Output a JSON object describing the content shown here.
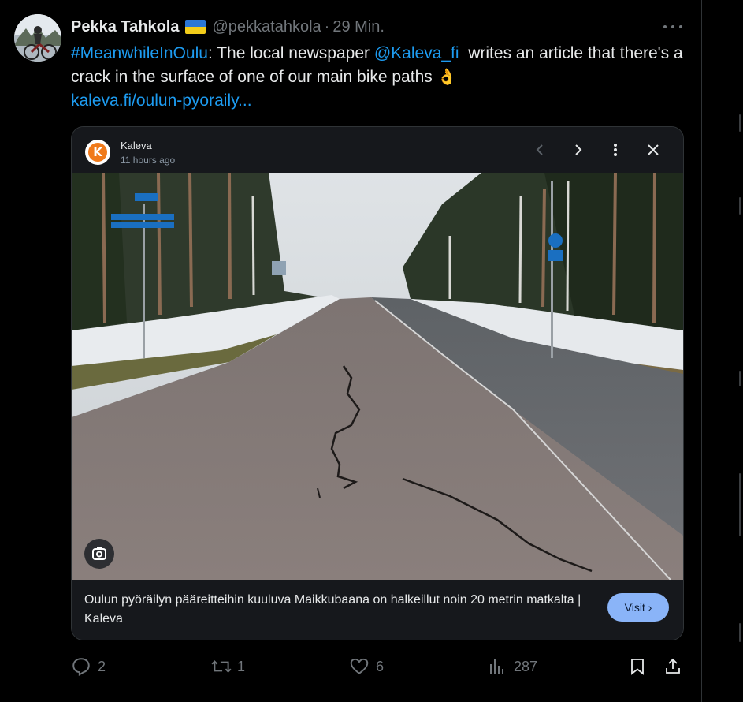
{
  "tweet": {
    "author_name": "Pekka Tahkola",
    "author_flag": "ukraine-flag",
    "handle": "@pekkatahkola",
    "separator": "·",
    "time": "29 Min.",
    "text": {
      "hashtag": "#MeanwhileInOulu",
      "part1": ": The local newspaper ",
      "mention": "@Kaleva_fi",
      "part2": "  writes an article that there's a crack in the surface of one of our main bike paths ",
      "emoji": "👌",
      "url": "kaleva.fi/oulun-pyoraily..."
    }
  },
  "card": {
    "source_letter": "K",
    "source": "Kaleva",
    "time": "11 hours ago",
    "caption": "Oulun pyöräilyn pääreitteihin kuuluva Maikkubaana on halkeillut noin 20 metrin matkalta | Kaleva",
    "visit_label": "Visit ›"
  },
  "actions": {
    "replies": "2",
    "reposts": "1",
    "likes": "6",
    "views": "287"
  },
  "colors": {
    "accent": "#1d9bf0",
    "visit_button": "#8ab4f8",
    "kaleva_orange": "#f07a1b"
  }
}
